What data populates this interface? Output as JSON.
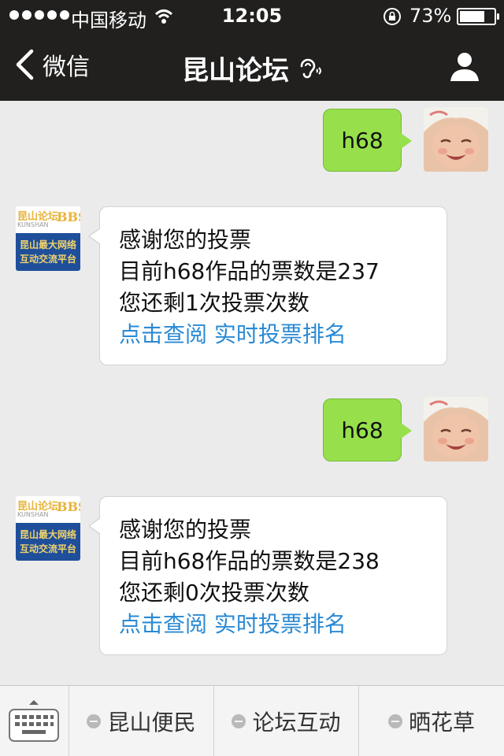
{
  "status_bar": {
    "carrier": "中国移动",
    "time": "12:05",
    "battery_percent": "73%",
    "battery_level": 0.73
  },
  "nav": {
    "back_label": "微信",
    "title": "昆山论坛",
    "ear_icon": "ear-icon",
    "profile_icon": "person-icon"
  },
  "messages": [
    {
      "direction": "out",
      "text": "h68"
    },
    {
      "direction": "in",
      "lines": [
        "感谢您的投票",
        "目前h68作品的票数是237",
        "您还剩1次投票次数"
      ],
      "links": [
        "点击查阅",
        "实时投票排名"
      ]
    },
    {
      "direction": "out",
      "text": "h68"
    },
    {
      "direction": "in",
      "lines": [
        "感谢您的投票",
        "目前h68作品的票数是238",
        "您还剩0次投票次数"
      ],
      "links": [
        "点击查阅",
        "实时投票排名"
      ]
    }
  ],
  "bot_avatar": {
    "brand": "昆山论坛",
    "brand_en": "KUNSHAN",
    "bbs": "BBS",
    "tagline_1": "昆山最大网络",
    "tagline_2": "互动交流平台"
  },
  "bottom_menu": {
    "items": [
      "昆山便民",
      "论坛互动",
      "晒花草"
    ]
  },
  "colors": {
    "nav_bg": "#21201f",
    "outgoing_bubble": "#97e04b",
    "link": "#2a8ad4",
    "bot_avatar_blue": "#1f4f9a",
    "bot_avatar_gold": "#e8b33a"
  }
}
